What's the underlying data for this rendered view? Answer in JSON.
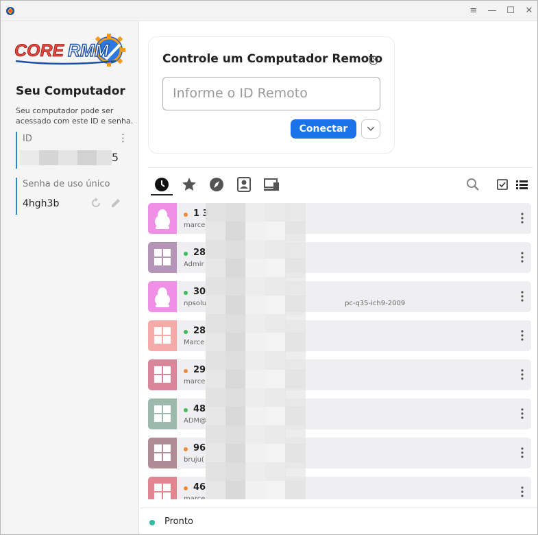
{
  "window": {
    "minimize_label": "—",
    "maximize_label": "☐",
    "close_label": "✕",
    "menu_label": "≡"
  },
  "sidebar": {
    "logo_text_core": "CORE",
    "logo_text_rmm": "RMM",
    "title": "Seu Computador",
    "description": "Seu computador pode ser acessado com este ID e senha.",
    "id_label": "ID",
    "id_value_suffix": "5",
    "password_label": "Senha de uso único",
    "password_value": "4hgh3b"
  },
  "connect": {
    "title": "Controle um Computador Remoto",
    "input_placeholder": "Informe o ID Remoto",
    "connect_button": "Conectar"
  },
  "tabs": [
    {
      "name": "recent",
      "icon": "clock-icon",
      "active": true
    },
    {
      "name": "favorites",
      "icon": "star-icon"
    },
    {
      "name": "discovered",
      "icon": "compass-icon"
    },
    {
      "name": "address-book",
      "icon": "address-book-icon"
    },
    {
      "name": "groups",
      "icon": "devices-icon"
    }
  ],
  "peers": [
    {
      "id": "1 3",
      "user": "marce",
      "extra": "",
      "os": "linux",
      "color": "#ef8fe6",
      "status": "#f0883c"
    },
    {
      "id": "28",
      "user": "Admir",
      "extra": "",
      "os": "windows",
      "color": "#b495b8",
      "status": "#3cba5c"
    },
    {
      "id": "30",
      "user": "npsolu",
      "extra": "pc-q35-ich9-2009",
      "os": "linux",
      "color": "#ef8fe6",
      "status": "#3cba5c"
    },
    {
      "id": "28",
      "user": "Marce",
      "extra": "",
      "os": "windows",
      "color": "#f4aaa6",
      "status": "#3cba5c"
    },
    {
      "id": "29",
      "user": "marce",
      "extra": "",
      "os": "windows",
      "color": "#d9869a",
      "status": "#f0883c"
    },
    {
      "id": "48",
      "user": "ADM@",
      "extra": "",
      "os": "windows",
      "color": "#9db9ab",
      "status": "#3cba5c"
    },
    {
      "id": "96",
      "user": "bruju(",
      "extra": "",
      "os": "windows",
      "color": "#b08c95",
      "status": "#f0883c"
    },
    {
      "id": "46",
      "user": "marce",
      "extra": "",
      "os": "windows",
      "color": "#e1868f",
      "status": "#f0883c"
    }
  ],
  "status": {
    "text": "Pronto",
    "color": "#30b8a0"
  }
}
